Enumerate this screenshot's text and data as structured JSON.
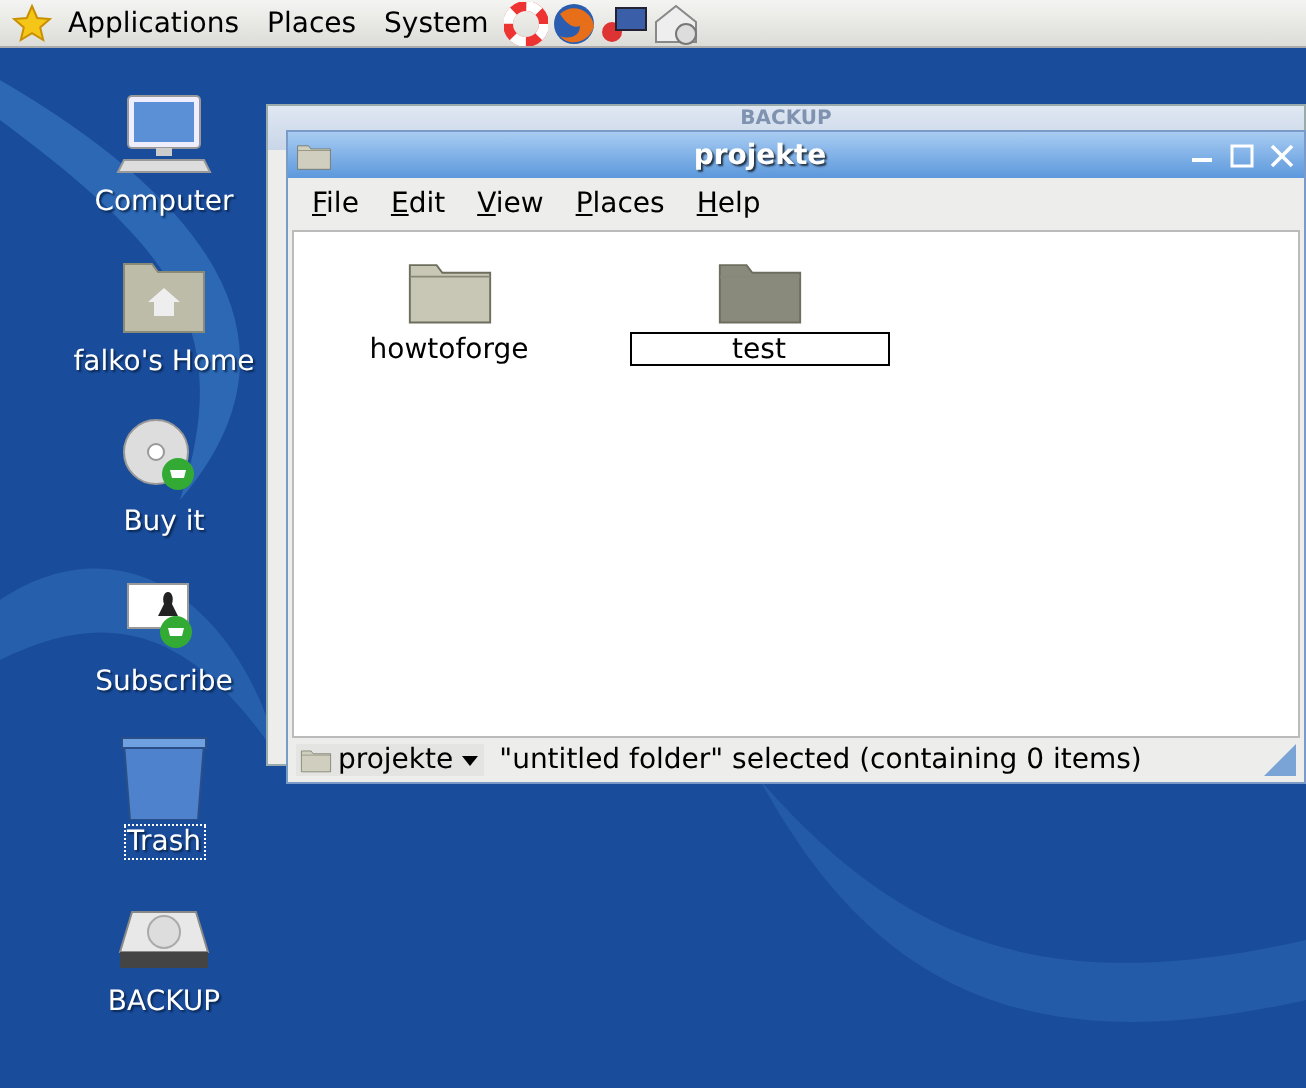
{
  "panel": {
    "menus": [
      "Applications",
      "Places",
      "System"
    ]
  },
  "desktop_icons": [
    {
      "label": "Computer",
      "kind": "computer",
      "selected": false
    },
    {
      "label": "falko's Home",
      "kind": "home",
      "selected": false
    },
    {
      "label": "Buy it",
      "kind": "disc",
      "selected": false
    },
    {
      "label": "Subscribe",
      "kind": "subscribe",
      "selected": false
    },
    {
      "label": "Trash",
      "kind": "trash",
      "selected": true
    },
    {
      "label": "BACKUP",
      "kind": "drive",
      "selected": false
    }
  ],
  "back_window": {
    "title": "BACKUP"
  },
  "window": {
    "title": "projekte",
    "menu": [
      "File",
      "Edit",
      "View",
      "Places",
      "Help"
    ],
    "items": [
      {
        "label": "howtoforge",
        "selected": false,
        "editing": false
      },
      {
        "label": "test",
        "selected": true,
        "editing": true
      }
    ],
    "status_bar": {
      "location": "projekte",
      "message": "\"untitled folder\" selected (containing 0 items)"
    }
  }
}
